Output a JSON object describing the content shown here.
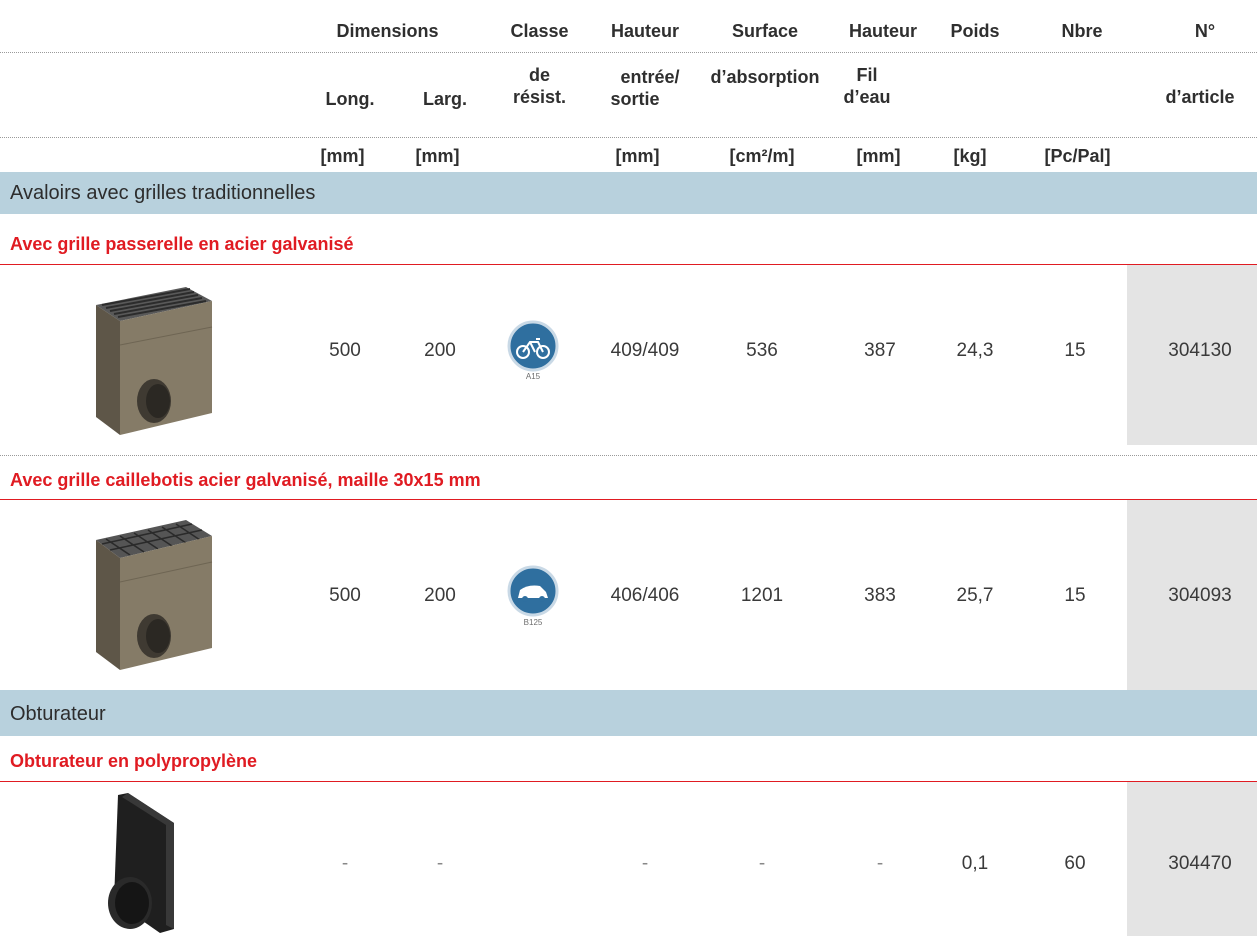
{
  "header": {
    "row1": {
      "dimensions": "Dimensions",
      "classe": "Classe",
      "hauteur": "Hauteur",
      "surface": "Surface",
      "hauteur2": "Hauteur",
      "poids": "Poids",
      "nbre": "Nbre",
      "numero": "N°"
    },
    "row2": {
      "long": "Long.",
      "larg": "Larg.",
      "de": "de",
      "resist": "résist.",
      "entree": "entrée/",
      "sortie": "sortie",
      "absorption": "d’absorption",
      "fil": "Fil",
      "deau": "d’eau",
      "article": "d’article"
    },
    "units": {
      "long": "[mm]",
      "larg": "[mm]",
      "hauteur": "[mm]",
      "surface": "[cm²/m]",
      "fil": "[mm]",
      "poids": "[kg]",
      "nbre": "[Pc/Pal]"
    }
  },
  "sections": [
    {
      "title": "Avaloirs avec grilles traditionnelles",
      "groups": [
        {
          "subtitle": "Avec grille passerelle en acier galvanisé",
          "row": {
            "long": "500",
            "larg": "200",
            "class_label": "A15",
            "hauteur": "409/409",
            "surface": "536",
            "fil": "387",
            "poids": "24,3",
            "nbre": "15",
            "article": "304130"
          },
          "class_icon": "bicycle-icon"
        },
        {
          "subtitle": "Avec grille caillebotis acier galvanisé, maille 30x15 mm",
          "row": {
            "long": "500",
            "larg": "200",
            "class_label": "B125",
            "hauteur": "406/406",
            "surface": "1201",
            "fil": "383",
            "poids": "25,7",
            "nbre": "15",
            "article": "304093"
          },
          "class_icon": "car-icon"
        }
      ]
    },
    {
      "title": "Obturateur",
      "groups": [
        {
          "subtitle": "Obturateur en polypropylène",
          "row": {
            "long": "-",
            "larg": "-",
            "hauteur": "-",
            "surface": "-",
            "fil": "-",
            "poids": "0,1",
            "nbre": "60",
            "article": "304470"
          }
        }
      ]
    }
  ],
  "colors": {
    "band": "#b8d1dd",
    "subtitle_red": "#e01b22",
    "article_bg": "#e4e4e4",
    "badge_blue": "#2f6f9f"
  }
}
